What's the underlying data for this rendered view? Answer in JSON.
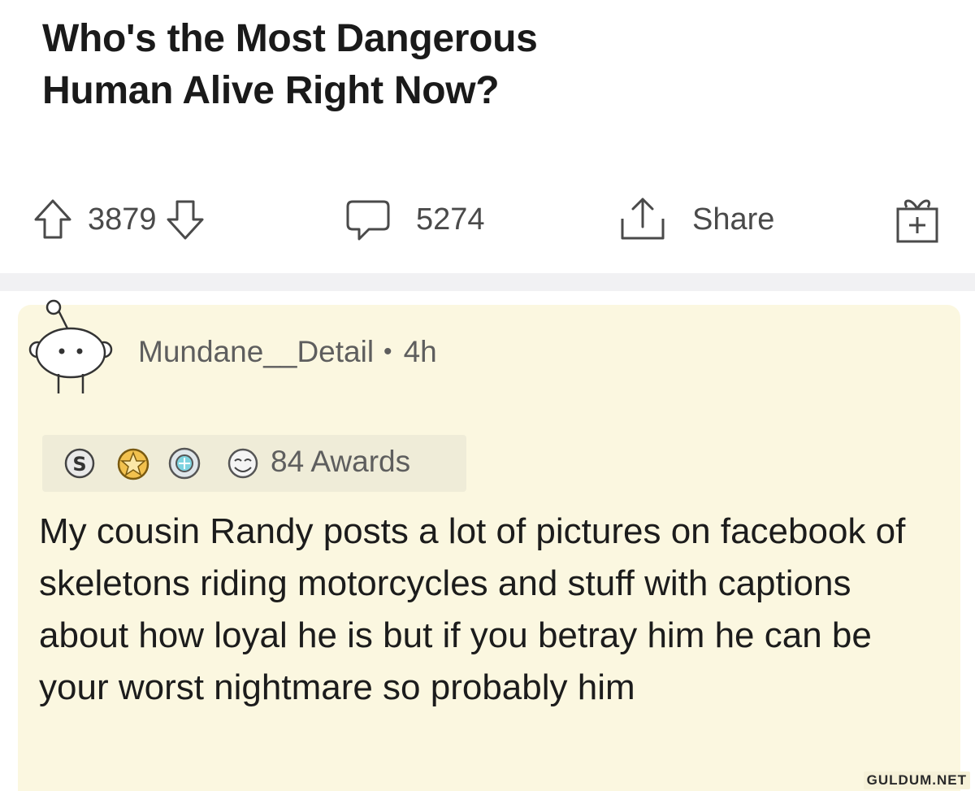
{
  "post": {
    "title_line1": "Who's the Most Dangerous",
    "title_line2": "Human Alive Right Now?"
  },
  "actions": {
    "upvotes": "3879",
    "comments": "5274",
    "share_label": "Share"
  },
  "comment": {
    "username": "Mundane__Detail",
    "separator": "•",
    "age": "4h",
    "awards_count_label": "84 Awards",
    "body": "My cousin Randy posts a lot of pictures on facebook of skeletons riding motorcycles and stuff with captions about how loyal he is but if you betray him he can be your worst nightmare so probably him"
  },
  "icons": [
    "upvote-arrow-icon",
    "downvote-arrow-icon",
    "comment-bubble-icon",
    "share-icon",
    "gift-award-icon",
    "snoo-avatar-icon",
    "silver-award-icon",
    "gold-award-icon",
    "platinum-award-icon",
    "wholesome-award-icon"
  ],
  "colors": {
    "comment_background": "#fbf7e0",
    "awards_background": "#efecd8",
    "separator": "#f1f1f3",
    "meta_text": "#5e5e5e"
  },
  "watermark": "GULDUM.NET"
}
